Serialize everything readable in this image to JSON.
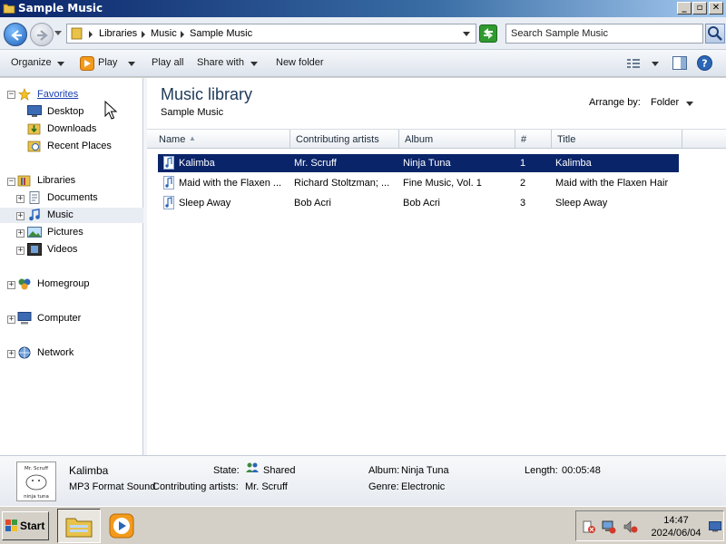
{
  "window": {
    "title": "Sample Music"
  },
  "address": {
    "crumbs": [
      "Libraries",
      "Music",
      "Sample Music"
    ],
    "search_placeholder": "Search Sample Music"
  },
  "toolbar": {
    "organize": "Organize",
    "play": "Play",
    "play_all": "Play all",
    "share_with": "Share with",
    "new_folder": "New folder"
  },
  "nav": {
    "favorites": "Favorites",
    "desktop": "Desktop",
    "downloads": "Downloads",
    "recent_places": "Recent Places",
    "libraries": "Libraries",
    "documents": "Documents",
    "music": "Music",
    "pictures": "Pictures",
    "videos": "Videos",
    "homegroup": "Homegroup",
    "computer": "Computer",
    "network": "Network"
  },
  "library": {
    "title": "Music library",
    "subtitle": "Sample Music",
    "arrange_label": "Arrange by:",
    "arrange_value": "Folder"
  },
  "columns": [
    "Name",
    "Contributing artists",
    "Album",
    "#",
    "Title"
  ],
  "rows": [
    {
      "name": "Kalimba",
      "artist": "Mr. Scruff",
      "album": "Ninja Tuna",
      "num": "1",
      "title": "Kalimba",
      "selected": true
    },
    {
      "name": "Maid with the Flaxen ...",
      "artist": "Richard Stoltzman; ...",
      "album": "Fine Music, Vol. 1",
      "num": "2",
      "title": "Maid with the Flaxen Hair",
      "selected": false
    },
    {
      "name": "Sleep Away",
      "artist": "Bob Acri",
      "album": "Bob Acri",
      "num": "3",
      "title": "Sleep Away",
      "selected": false
    }
  ],
  "details": {
    "name": "Kalimba",
    "type": "MP3 Format Sound",
    "state_label": "State:",
    "state_value": "Shared",
    "contrib_label": "Contributing artists:",
    "contrib_value": "Mr. Scruff",
    "album_label": "Album:",
    "album_value": "Ninja Tuna",
    "genre_label": "Genre:",
    "genre_value": "Electronic",
    "length_label": "Length:",
    "length_value": "00:05:48",
    "album_art_text": [
      "Mr. Scruff",
      "ninja tuna"
    ]
  },
  "taskbar": {
    "start": "Start",
    "time": "14:47",
    "date": "2024/06/04"
  },
  "colors": {
    "selection": "#0a246a",
    "title_gradient_start": "#0a246a",
    "link": "#1a3fb0"
  }
}
